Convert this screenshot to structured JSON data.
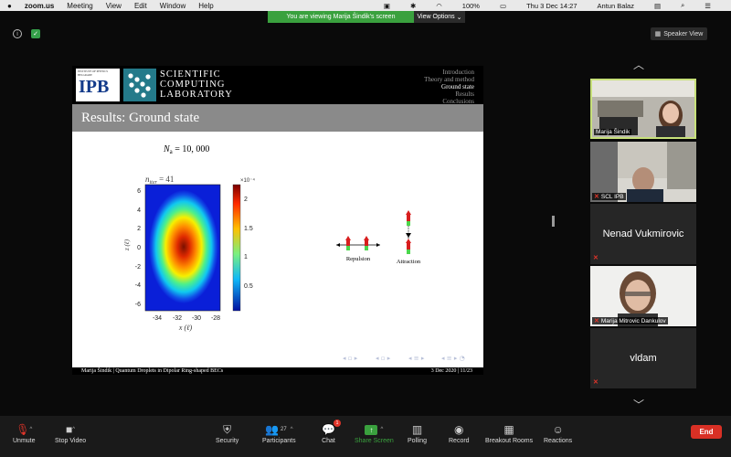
{
  "menubar": {
    "app": "zoom.us",
    "items": [
      "Meeting",
      "View",
      "Edit",
      "Window",
      "Help"
    ],
    "battery": "100%",
    "datetime": "Thu 3 Dec  14:27",
    "user": "Antun Balaz"
  },
  "banner": {
    "text": "You are viewing Marija Šindik's screen",
    "options": "View Options"
  },
  "speaker_view": "Speaker View",
  "slide": {
    "ipb_small": "INSTITUTE OF PHYSICS BELGRADE",
    "ipb_big": "IPB",
    "scl_lines": [
      "SCIENTIFIC",
      "COMPUTING",
      "LABORATORY"
    ],
    "nav": [
      "Introduction",
      "Theory and method",
      "Ground state",
      "Results",
      "Conclusions"
    ],
    "title": "Results: Ground state",
    "na_label": "N",
    "na_sub": "a",
    "na_value": " = 10, 000",
    "niter_label": "n",
    "niter_sub": "iter",
    "niter_value": " = 41",
    "colorbar_exp": "×10⁻⁴",
    "colorbar_ticks": [
      "2",
      "1.5",
      "1",
      "0.5"
    ],
    "y_ticks": [
      "6",
      "4",
      "2",
      "0",
      "-2",
      "-4",
      "-6"
    ],
    "x_ticks": [
      "-34",
      "-32",
      "-30",
      "-28"
    ],
    "x_label": "x (ℓ)",
    "y_label": "z (ℓ)",
    "repulsion": "Repulsion",
    "attraction": "Attraction",
    "footer_left": "Marija Šindik  |  Quantum Droplets in Dipolar Ring-shaped BECs",
    "footer_right": "3 Dec 2020  |  11/23"
  },
  "participants": [
    {
      "name": "Marija Šindik",
      "video": true
    },
    {
      "name": "SCL IPB",
      "video": true
    },
    {
      "name": "Nenad Vukmirovic",
      "video": false
    },
    {
      "name": "Marija Mitrovic Dankulov",
      "video": true
    },
    {
      "name": "vldam",
      "video": false
    }
  ],
  "toolbar": {
    "unmute": "Unmute",
    "stop_video": "Stop Video",
    "security": "Security",
    "participants": "Participants",
    "participants_count": "27",
    "chat": "Chat",
    "chat_badge": "1",
    "share_screen": "Share Screen",
    "polling": "Polling",
    "record": "Record",
    "breakout": "Breakout Rooms",
    "reactions": "Reactions",
    "end": "End"
  },
  "colors": {
    "share_green": "#3aa13e",
    "end_red": "#d93025",
    "active_speaker": "#c7e07a"
  }
}
